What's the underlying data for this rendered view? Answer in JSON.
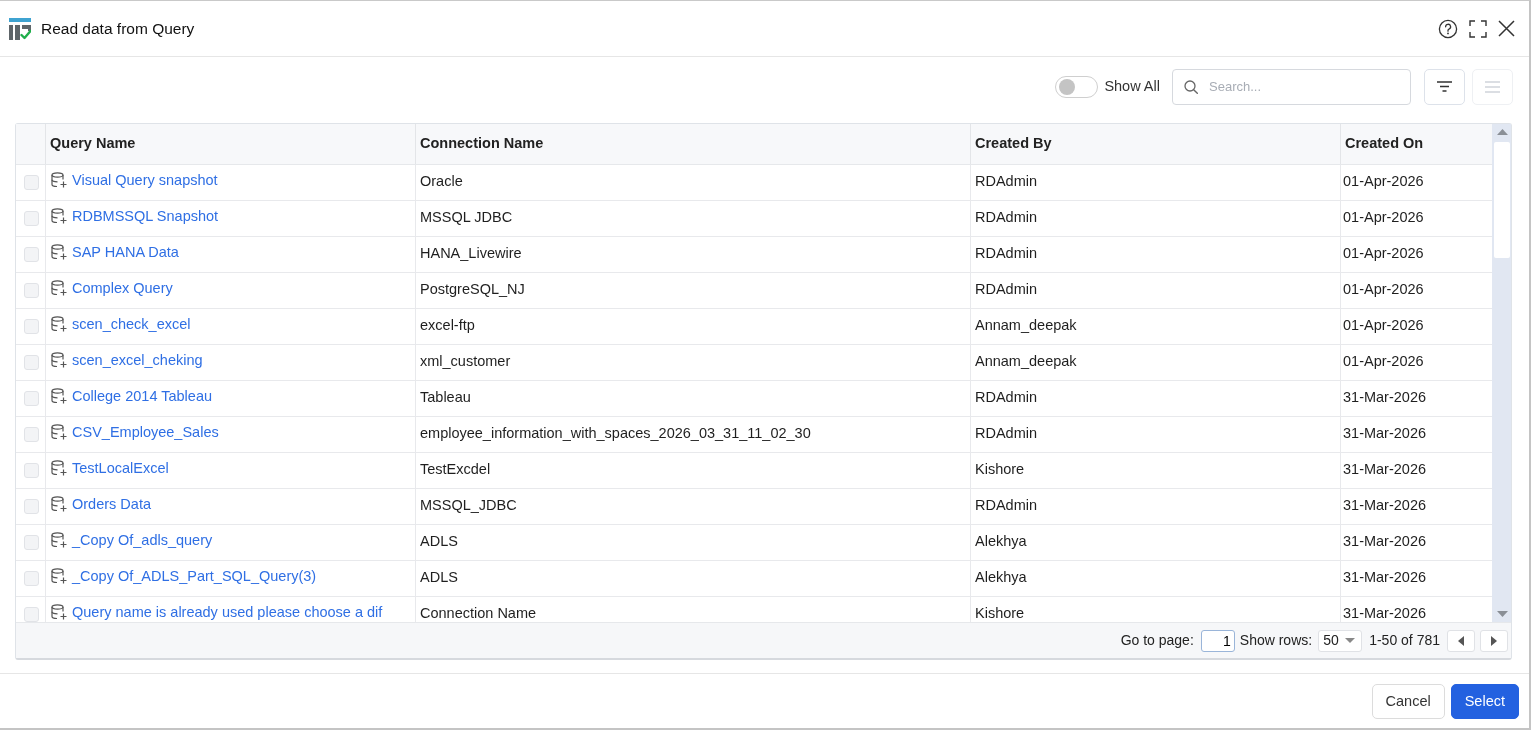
{
  "window": {
    "title": "Read data from Query"
  },
  "toolbar": {
    "show_all": {
      "label": "Show All",
      "on": false
    },
    "search": {
      "placeholder": "Search..."
    },
    "buttons": [
      {
        "kind": "filter",
        "disabled": false
      },
      {
        "kind": "menu",
        "disabled": true
      }
    ]
  },
  "table": {
    "columns": [
      "Query Name",
      "Connection Name",
      "Created By",
      "Created On"
    ],
    "rows": [
      {
        "checked": false,
        "cells": [
          "Visual Query snapshot",
          "Oracle",
          "RDAdmin",
          "01-Apr-2026"
        ]
      },
      {
        "checked": false,
        "cells": [
          "RDBMSSQL Snapshot",
          "MSSQL JDBC",
          "RDAdmin",
          "01-Apr-2026"
        ]
      },
      {
        "checked": false,
        "cells": [
          "SAP HANA Data",
          "HANA_Livewire",
          "RDAdmin",
          "01-Apr-2026"
        ]
      },
      {
        "checked": false,
        "cells": [
          "Complex Query",
          "PostgreSQL_NJ",
          "RDAdmin",
          "01-Apr-2026"
        ]
      },
      {
        "checked": false,
        "cells": [
          "scen_check_excel",
          "excel-ftp",
          "Annam_deepak",
          "01-Apr-2026"
        ]
      },
      {
        "checked": false,
        "cells": [
          "scen_excel_cheking",
          "xml_customer",
          "Annam_deepak",
          "01-Apr-2026"
        ]
      },
      {
        "checked": false,
        "cells": [
          "College 2014 Tableau",
          "Tableau",
          "RDAdmin",
          "31-Mar-2026"
        ]
      },
      {
        "checked": false,
        "cells": [
          "CSV_Employee_Sales",
          "employee_information_with_spaces_2026_03_31_11_02_30",
          "RDAdmin",
          "31-Mar-2026"
        ]
      },
      {
        "checked": false,
        "cells": [
          "TestLocalExcel",
          "TestExcdel",
          "Kishore",
          "31-Mar-2026"
        ]
      },
      {
        "checked": false,
        "cells": [
          "Orders Data",
          "MSSQL_JDBC",
          "RDAdmin",
          "31-Mar-2026"
        ]
      },
      {
        "checked": false,
        "cells": [
          "_Copy Of_adls_query",
          "ADLS",
          "Alekhya",
          "31-Mar-2026"
        ]
      },
      {
        "checked": false,
        "cells": [
          "_Copy Of_ADLS_Part_SQL_Query(3)",
          "ADLS",
          "Alekhya",
          "31-Mar-2026"
        ]
      },
      {
        "checked": false,
        "cells": [
          "Query name is already used please choose a dif",
          "Connection Name",
          "Kishore",
          "31-Mar-2026"
        ]
      }
    ]
  },
  "pagination": {
    "go_to_label": "Go to page:",
    "page": "1",
    "rows_label": "Show rows:",
    "rows_per_page": "50",
    "range": "1-50 of 781"
  },
  "buttons": [
    {
      "label": "Cancel",
      "kind": "secondary"
    },
    {
      "label": "Select",
      "kind": "primary"
    }
  ]
}
